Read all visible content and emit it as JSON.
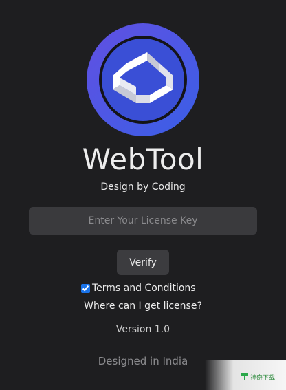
{
  "app": {
    "title": "WebTool",
    "tagline": "Design by Coding"
  },
  "license": {
    "placeholder": "Enter Your License Key",
    "value": ""
  },
  "verify": {
    "label": "Verify"
  },
  "terms": {
    "label": "Terms and Conditions",
    "checked": true
  },
  "help_link": {
    "label": "Where can I get license?"
  },
  "version": "Version 1.0",
  "footer": "Designed in India",
  "watermark": {
    "text": "神奇下载"
  },
  "colors": {
    "background": "#1e1e20",
    "logo_gradient_start": "#5b53e0",
    "logo_gradient_end": "#3f5fe4",
    "logo_inner": "#3a4fd6",
    "input_bg": "#3a3a3d",
    "button_bg": "#3c3c3f",
    "checkbox": "#1a73e8"
  },
  "icons": {
    "logo": "webtool-logo-icon",
    "watermark": "watermark-logo-icon"
  }
}
